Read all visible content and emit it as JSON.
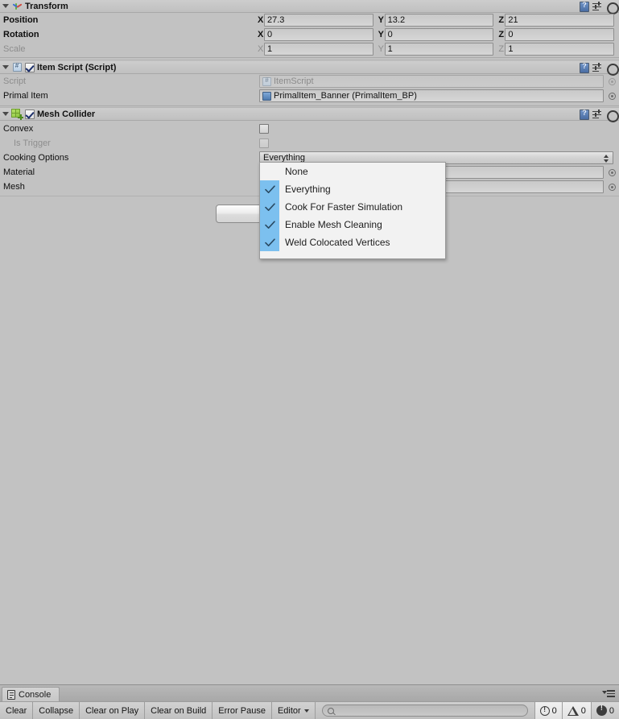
{
  "inspector": {
    "components": [
      {
        "name": "transform",
        "title": "Transform",
        "icon": "transform-axis-icon",
        "has_enable_checkbox": false,
        "rows": [
          {
            "kind": "vector3",
            "label": "Position",
            "dim": false,
            "axes": [
              {
                "axis": "X",
                "value": "27.3"
              },
              {
                "axis": "Y",
                "value": "13.2"
              },
              {
                "axis": "Z",
                "value": "21"
              }
            ]
          },
          {
            "kind": "vector3",
            "label": "Rotation",
            "dim": false,
            "axes": [
              {
                "axis": "X",
                "value": "0"
              },
              {
                "axis": "Y",
                "value": "0"
              },
              {
                "axis": "Z",
                "value": "0"
              }
            ]
          },
          {
            "kind": "vector3",
            "label": "Scale",
            "dim": true,
            "axes": [
              {
                "axis": "X",
                "value": "1"
              },
              {
                "axis": "Y",
                "value": "1"
              },
              {
                "axis": "Z",
                "value": "1"
              }
            ]
          }
        ]
      },
      {
        "name": "item-script",
        "title": "Item Script (Script)",
        "icon": "csharp-script-icon",
        "has_enable_checkbox": true,
        "enabled": true,
        "rows": [
          {
            "kind": "object",
            "label": "Script",
            "dim": true,
            "value": "ItemScript",
            "icon": "csharp-script-icon"
          },
          {
            "kind": "object",
            "label": "Primal Item",
            "dim": false,
            "value": "PrimalItem_Banner (PrimalItem_BP)",
            "icon": "prefab-icon"
          }
        ]
      },
      {
        "name": "mesh-collider",
        "title": "Mesh Collider",
        "icon": "mesh-collider-icon",
        "has_enable_checkbox": true,
        "enabled": true,
        "rows": [
          {
            "kind": "bool",
            "label": "Convex",
            "dim": false,
            "checked": false
          },
          {
            "kind": "bool",
            "label": "Is Trigger",
            "dim": true,
            "indent": true,
            "checked": false
          },
          {
            "kind": "enum",
            "label": "Cooking Options",
            "dim": false,
            "value": "Everything"
          },
          {
            "kind": "object",
            "label": "Material",
            "dim": false,
            "value": ""
          },
          {
            "kind": "object",
            "label": "Mesh",
            "dim": false,
            "value": ""
          }
        ]
      }
    ],
    "header_icons": {
      "help": "help-book-icon",
      "preset": "preset-icon",
      "gear": "gear-icon"
    },
    "edit_collider_button_label": ""
  },
  "dropdown": {
    "name": "cooking-options-dropdown",
    "items": [
      {
        "label": "None",
        "checked": false
      },
      {
        "label": "Everything",
        "checked": true
      },
      {
        "label": "Cook For Faster Simulation",
        "checked": true
      },
      {
        "label": "Enable Mesh Cleaning",
        "checked": true
      },
      {
        "label": "Weld Colocated Vertices",
        "checked": true
      }
    ],
    "highlight_color": "#7cc0ef"
  },
  "console": {
    "tab_label": "Console",
    "tab_icon": "console-icon",
    "panel_menu_icon": "panel-menu-icon",
    "toolbar": {
      "clear": "Clear",
      "collapse": "Collapse",
      "clear_on_play": "Clear on Play",
      "clear_on_build": "Clear on Build",
      "error_pause": "Error Pause",
      "editor": "Editor"
    },
    "search": {
      "value": "",
      "placeholder": ""
    },
    "counters": [
      {
        "icon": "info-icon",
        "count": "0"
      },
      {
        "icon": "warning-icon",
        "count": "0"
      },
      {
        "icon": "error-icon",
        "count": "0"
      }
    ]
  },
  "colors": {
    "background": "#c2c2c2",
    "header": "#c8c8c8",
    "dropdown_bg": "#f2f2f2",
    "dropdown_highlight": "#7cc0ef",
    "axis_x": "#d04a3e",
    "axis_y": "#62b044",
    "axis_z": "#3f6fd0"
  }
}
